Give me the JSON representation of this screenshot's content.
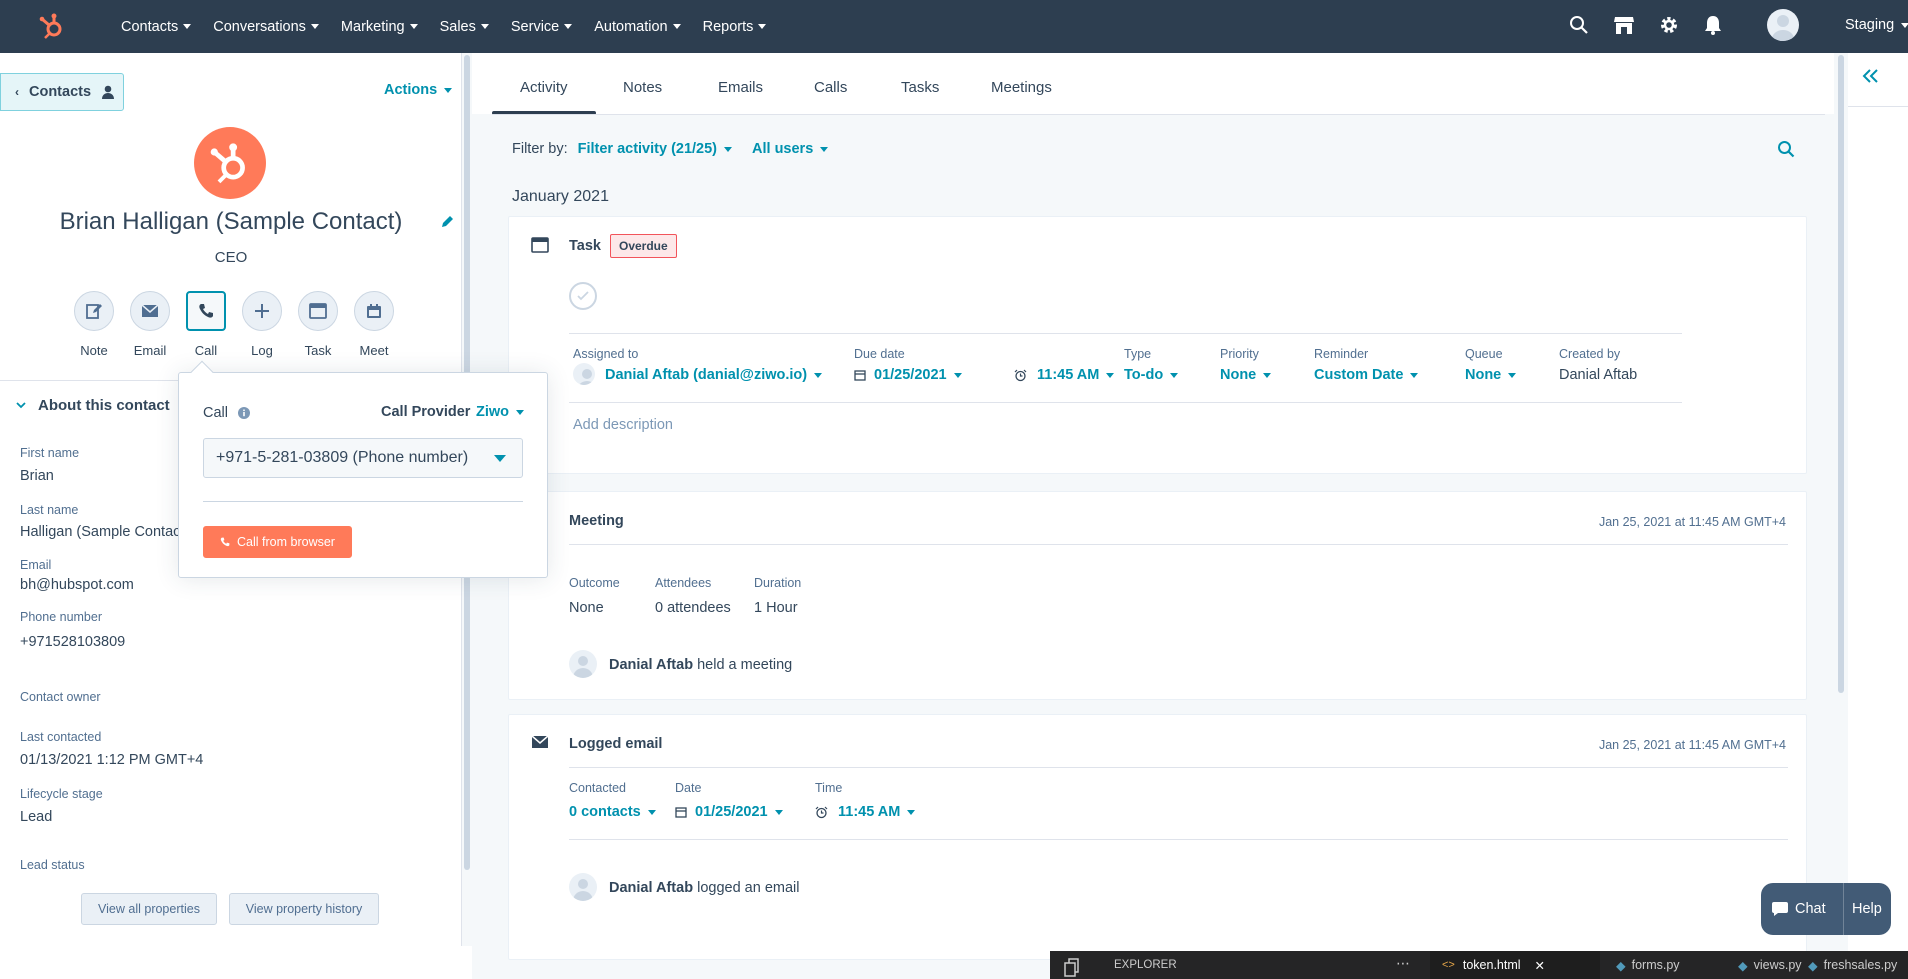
{
  "nav": {
    "items": [
      "Contacts",
      "Conversations",
      "Marketing",
      "Sales",
      "Service",
      "Automation",
      "Reports"
    ],
    "account": "Staging"
  },
  "contact": {
    "back_label": "Contacts",
    "actions_label": "Actions",
    "name": "Brian Halligan (Sample Contact)",
    "title": "CEO",
    "activity_buttons": [
      "Note",
      "Email",
      "Call",
      "Log",
      "Task",
      "Meet"
    ],
    "about_heading": "About this contact",
    "properties": [
      {
        "label": "First name",
        "value": "Brian"
      },
      {
        "label": "Last name",
        "value": "Halligan (Sample Contact)"
      },
      {
        "label": "Email",
        "value": "bh@hubspot.com"
      },
      {
        "label": "Phone number",
        "value": "+971528103809"
      },
      {
        "label": "Contact owner",
        "value": ""
      },
      {
        "label": "Last contacted",
        "value": "01/13/2021 1:12 PM GMT+4"
      },
      {
        "label": "Lifecycle stage",
        "value": "Lead"
      },
      {
        "label": "Lead status",
        "value": ""
      }
    ],
    "view_all_label": "View all properties",
    "view_history_label": "View property history"
  },
  "call_popover": {
    "title": "Call",
    "provider_label": "Call Provider",
    "provider_value": "Ziwo",
    "phone_selected": "+971-5-281-03809 (Phone number)",
    "call_button": "Call from browser"
  },
  "tabs": [
    "Activity",
    "Notes",
    "Emails",
    "Calls",
    "Tasks",
    "Meetings"
  ],
  "filter": {
    "label": "Filter by:",
    "activity": "Filter activity (21/25)",
    "users": "All users"
  },
  "month_heading": "January 2021",
  "task_card": {
    "title": "Task",
    "badge": "Overdue",
    "fields": [
      {
        "label": "Assigned to",
        "value": "Danial Aftab (danial@ziwo.io)"
      },
      {
        "label": "Due date",
        "value": "01/25/2021",
        "time": "11:45 AM"
      },
      {
        "label": "Type",
        "value": "To-do"
      },
      {
        "label": "Priority",
        "value": "None"
      },
      {
        "label": "Reminder",
        "value": "Custom Date"
      },
      {
        "label": "Queue",
        "value": "None"
      },
      {
        "label": "Created by",
        "value": "Danial Aftab"
      }
    ],
    "description_placeholder": "Add description"
  },
  "meeting_card": {
    "title": "Meeting",
    "timestamp": "Jan 25, 2021 at 11:45 AM GMT+4",
    "fields": [
      {
        "label": "Outcome",
        "value": "None"
      },
      {
        "label": "Attendees",
        "value": "0 attendees"
      },
      {
        "label": "Duration",
        "value": "1 Hour"
      }
    ],
    "actor": "Danial Aftab",
    "action": "held a meeting"
  },
  "email_card": {
    "title": "Logged email",
    "timestamp": "Jan 25, 2021 at 11:45 AM GMT+4",
    "fields": [
      {
        "label": "Contacted",
        "value": "0 contacts"
      },
      {
        "label": "Date",
        "value": "01/25/2021"
      },
      {
        "label": "Time",
        "value": "11:45 AM"
      }
    ],
    "actor": "Danial Aftab",
    "action": "logged an email"
  },
  "chat_widget": {
    "chat": "Chat",
    "help": "Help"
  },
  "editor": {
    "explorer": "EXPLORER",
    "tabs": [
      "token.html",
      "forms.py",
      "views.py",
      "freshsales.py"
    ]
  },
  "colors": {
    "nav_bg": "#2d3e50",
    "accent": "#0091ae",
    "brand": "#ff7a59",
    "text": "#33475b",
    "overdue": "#f2545b"
  }
}
